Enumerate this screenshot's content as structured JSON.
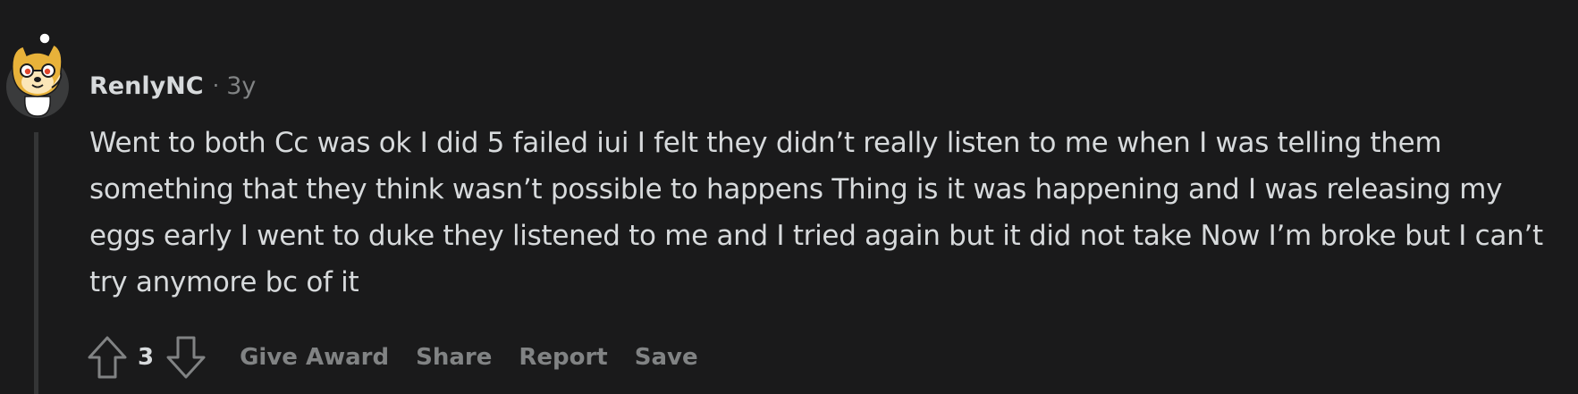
{
  "comment": {
    "author": "RenlyNC",
    "separator": "·",
    "age": "3y",
    "avatar_icon": "snoo-avatar-icon",
    "body": "Went to both Cc was ok I did 5 failed iui I felt they didn’t really listen to me when I was telling them something that they think wasn’t possible to happens Thing is it was happening and I was releasing my eggs early I went to duke they listened to me and I tried again but it did not take Now I’m broke but I can’t try anymore bc of it",
    "score": "3",
    "actions": {
      "upvote_icon": "arrow-up-icon",
      "downvote_icon": "arrow-down-icon",
      "give_award": "Give Award",
      "share": "Share",
      "report": "Report",
      "save": "Save"
    }
  },
  "colors": {
    "background": "#1a1a1b",
    "text": "#d7dadc",
    "muted": "#818384",
    "thread_line": "#343536"
  }
}
